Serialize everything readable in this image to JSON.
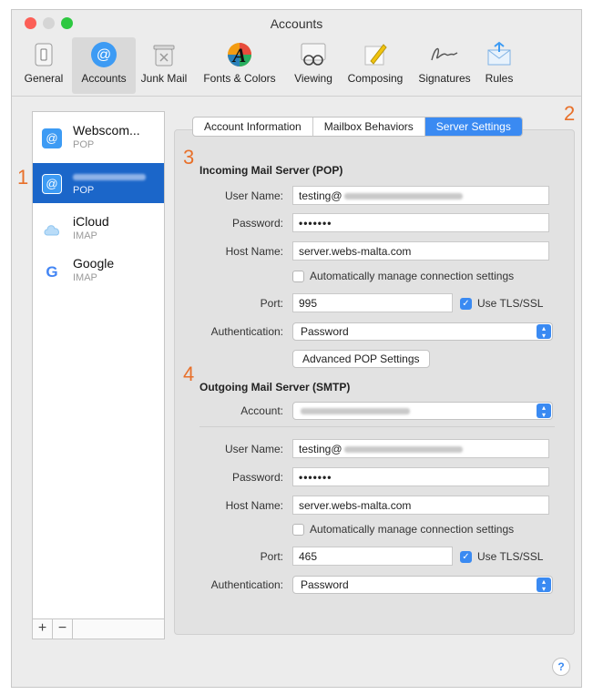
{
  "window": {
    "title": "Accounts"
  },
  "toolbar": {
    "items": [
      {
        "label": "General",
        "icon": "general-switch-icon"
      },
      {
        "label": "Accounts",
        "icon": "at-sign-icon"
      },
      {
        "label": "Junk Mail",
        "icon": "junk-mail-trash-icon"
      },
      {
        "label": "Fonts & Colors",
        "icon": "fonts-colors-icon"
      },
      {
        "label": "Viewing",
        "icon": "viewing-glasses-icon"
      },
      {
        "label": "Composing",
        "icon": "composing-pencil-icon"
      },
      {
        "label": "Signatures",
        "icon": "signature-icon"
      },
      {
        "label": "Rules",
        "icon": "rules-envelope-icon"
      }
    ],
    "active": "Accounts"
  },
  "accounts": {
    "items": [
      {
        "name": "Webscom...",
        "type": "POP",
        "icon": "at-sign-icon"
      },
      {
        "name": "",
        "type": "POP",
        "icon": "at-sign-icon"
      },
      {
        "name": "iCloud",
        "type": "IMAP",
        "icon": "icloud-icon"
      },
      {
        "name": "Google",
        "type": "IMAP",
        "icon": "google-icon"
      }
    ],
    "add_label": "+",
    "remove_label": "−"
  },
  "tabs": {
    "items": [
      "Account Information",
      "Mailbox Behaviors",
      "Server Settings"
    ],
    "active": "Server Settings"
  },
  "markers": {
    "m1": "1",
    "m2": "2",
    "m3": "3",
    "m4": "4"
  },
  "incoming": {
    "title": "Incoming Mail Server (POP)",
    "user_label": "User Name:",
    "user_value": "testing@",
    "password_label": "Password:",
    "password_value": "•••••••",
    "host_label": "Host Name:",
    "host_value": "server.webs-malta.com",
    "auto_manage_label": "Automatically manage connection settings",
    "port_label": "Port:",
    "port_value": "995",
    "tls_label": "Use TLS/SSL",
    "auth_label": "Authentication:",
    "auth_value": "Password",
    "advanced_label": "Advanced POP Settings"
  },
  "outgoing": {
    "title": "Outgoing Mail Server (SMTP)",
    "account_label": "Account:",
    "user_label": "User Name:",
    "user_value": "testing@",
    "password_label": "Password:",
    "password_value": "•••••••",
    "host_label": "Host Name:",
    "host_value": "server.webs-malta.com",
    "auto_manage_label": "Automatically manage connection settings",
    "port_label": "Port:",
    "port_value": "465",
    "tls_label": "Use TLS/SSL",
    "auth_label": "Authentication:",
    "auth_value": "Password"
  },
  "help": {
    "label": "?"
  },
  "colors": {
    "accent": "#3a8af2",
    "selection": "#1b66c9",
    "marker": "#e8702a"
  }
}
